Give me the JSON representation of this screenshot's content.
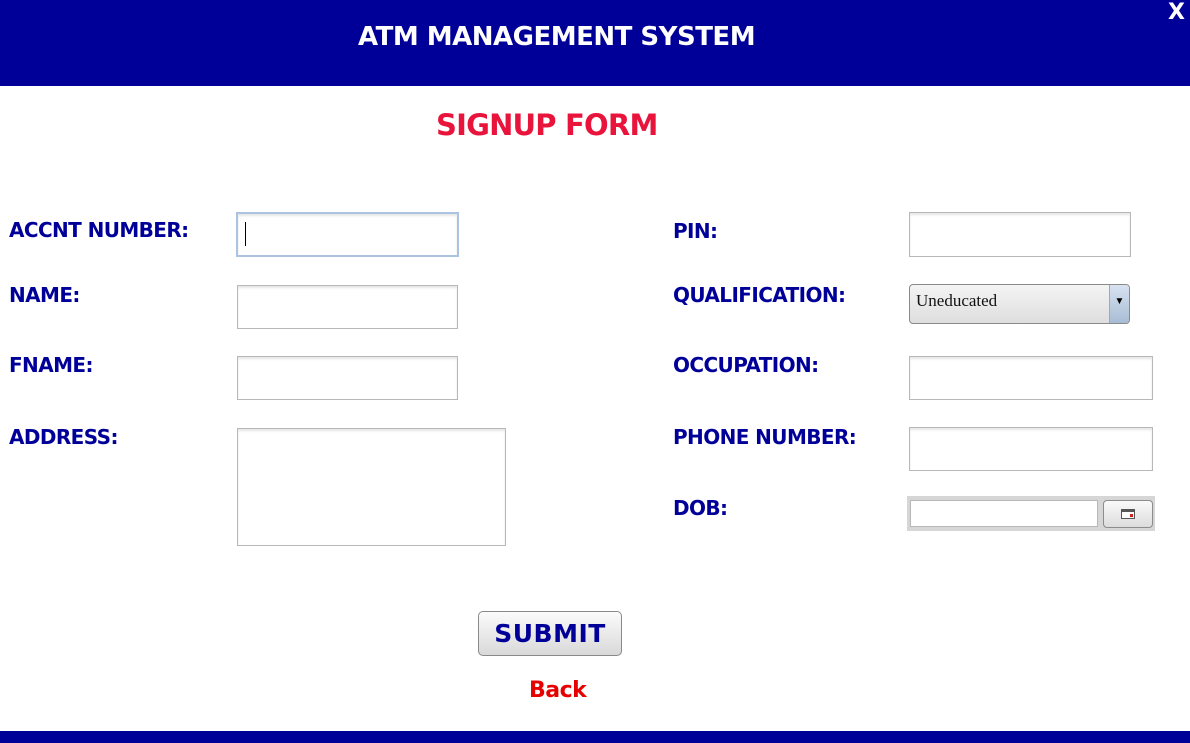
{
  "app": {
    "title": "ATM MANAGEMENT SYSTEM",
    "close_label": "X"
  },
  "form": {
    "title": "SIGNUP FORM",
    "labels": {
      "account_number": "ACCNT NUMBER:",
      "name": "NAME:",
      "fname": "FNAME:",
      "address": "ADDRESS:",
      "pin": "PIN:",
      "qualification": "QUALIFICATION:",
      "occupation": "OCCUPATION:",
      "phone_number": "PHONE NUMBER:",
      "dob": "DOB:"
    },
    "values": {
      "account_number": "",
      "name": "",
      "fname": "",
      "address": "",
      "pin": "",
      "occupation": "",
      "phone_number": "",
      "dob": ""
    },
    "qualification_selected": "Uneducated",
    "submit_label": "SUBMIT",
    "back_label": "Back"
  },
  "icons": {
    "close": "close-icon",
    "combo_arrow": "chevron-down-icon",
    "date_picker": "calendar-icon"
  },
  "colors": {
    "header_bg": "#000099",
    "label": "#000099",
    "form_title": "#e8143c",
    "back_link": "#e60000"
  }
}
